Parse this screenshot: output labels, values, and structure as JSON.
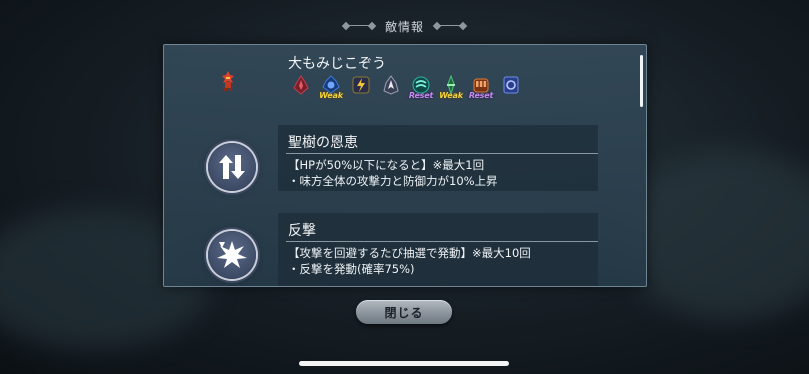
{
  "header": {
    "title": "敵情報"
  },
  "enemy": {
    "name": "大もみじこぞう",
    "affinities": [
      {
        "icon": "sword-icon",
        "tag": ""
      },
      {
        "icon": "water-icon",
        "tag": "Weak"
      },
      {
        "icon": "thunder-icon",
        "tag": ""
      },
      {
        "icon": "flame-icon",
        "tag": ""
      },
      {
        "icon": "wind-icon",
        "tag": "Reset"
      },
      {
        "icon": "light-icon",
        "tag": "Weak"
      },
      {
        "icon": "fist-icon",
        "tag": "Reset"
      },
      {
        "icon": "magic-icon",
        "tag": ""
      }
    ]
  },
  "skills": [
    {
      "icon": "stat-arrows-icon",
      "title": "聖樹の恩恵",
      "line1": "【HPが50%以下になると】※最大1回",
      "line2": "・味方全体の攻撃力と防御力が10%上昇"
    },
    {
      "icon": "counter-burst-icon",
      "title": "反撃",
      "line1": "【攻撃を回避するたび抽選で発動】※最大10回",
      "line2": "・反撃を発動(確率75%)"
    }
  ],
  "buttons": {
    "close": "閉じる"
  },
  "colors": {
    "weak_tag": "#f2d33c",
    "reset_tag": "#c58cf0",
    "panel": "#2f4a5c"
  }
}
